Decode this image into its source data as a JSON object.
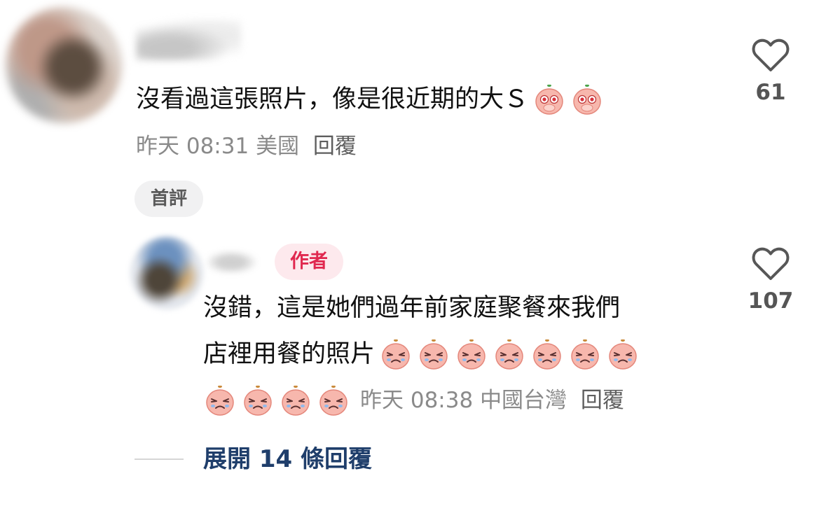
{
  "comments": [
    {
      "text": "沒看過這張照片，像是很近期的大Ｓ",
      "emoji_count": 2,
      "emoji_icon": "peach-shocked-emoji",
      "time": "昨天 08:31",
      "location": "美國",
      "reply_label": "回覆",
      "badge": "首評",
      "likes": "61"
    }
  ],
  "reply": {
    "author_badge": "作者",
    "text_line1": "沒錯，這是她們過年前家庭聚餐來我們",
    "text_line2": "店裡用餐的照片",
    "emoji_icon": "peach-crying-emoji",
    "emoji_count_line2": 7,
    "emoji_count_line3": 4,
    "time": "昨天 08:38",
    "location": "中國台灣",
    "reply_label": "回覆",
    "likes": "107"
  },
  "expand": {
    "label": "展開 14 條回覆"
  },
  "colors": {
    "meta_gray": "#8a8a8a",
    "author_red": "#e0284f",
    "author_bg": "#fde9ed",
    "expand_blue": "#1f3e6b",
    "badge_bg": "#f1f1f2"
  }
}
